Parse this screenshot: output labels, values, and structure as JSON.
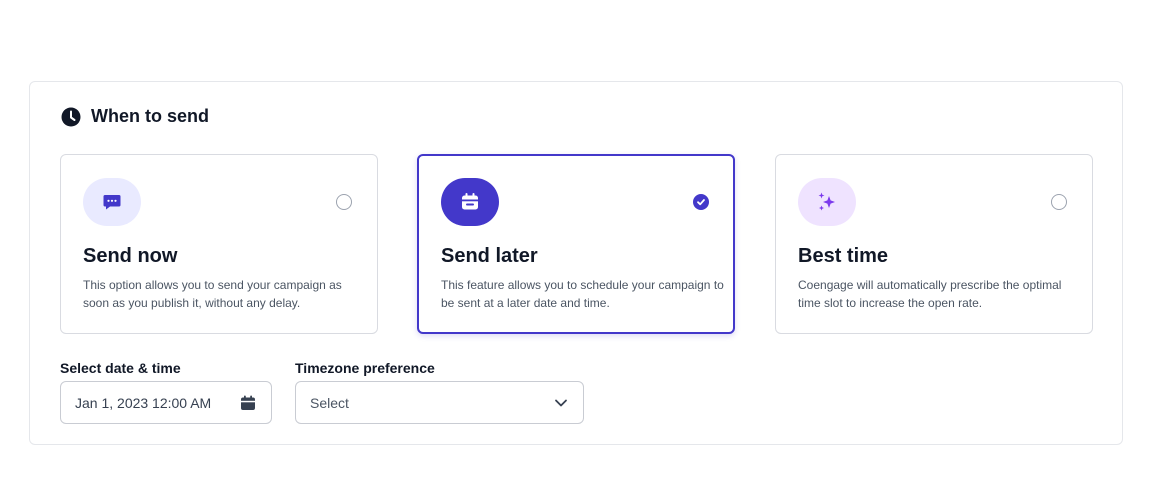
{
  "section": {
    "title": "When to send",
    "icon": "clock-icon"
  },
  "options": [
    {
      "id": "send-now",
      "title": "Send now",
      "description": "This option allows you to send your campaign as soon as you publish it, without any delay.",
      "icon": "chat-bubble-icon",
      "selected": false
    },
    {
      "id": "send-later",
      "title": "Send later",
      "description": "This feature allows you to schedule your campaign to be sent at a later date and time.",
      "icon": "calendar-icon",
      "selected": true
    },
    {
      "id": "best-time",
      "title": "Best time",
      "description": "Coengage will automatically prescribe the optimal time slot to increase the open rate.",
      "icon": "sparkles-icon",
      "selected": false
    }
  ],
  "datetime": {
    "label": "Select date & time",
    "value": "Jan 1, 2023 12:00 AM",
    "icon": "calendar-icon"
  },
  "timezone": {
    "label": "Timezone preference",
    "value": "Select",
    "icon": "chevron-down-icon"
  },
  "colors": {
    "accent": "#4338ca",
    "border": "#d9dbe1",
    "badge_light": "#e9eaff",
    "badge_purple": "#efe3ff",
    "sparkle": "#7c3aed"
  }
}
